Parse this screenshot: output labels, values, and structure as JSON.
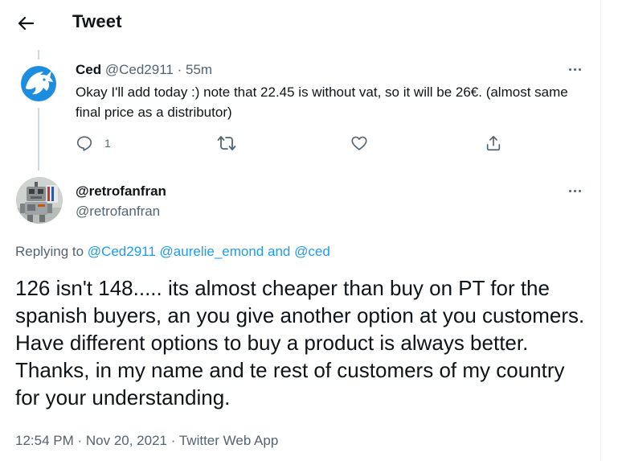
{
  "header": {
    "title": "Tweet",
    "back_icon": "arrow-left-icon"
  },
  "parent_tweet": {
    "avatar_icon": "blue-dragon-logo",
    "name": "Ced",
    "handle": "@Ced2911",
    "separator": "·",
    "time": "55m",
    "text": "Okay I'll add today :) note that 22.45 is without vat, so it will be 26€. (almost same final price as a distributor)",
    "actions": {
      "reply_count": "1",
      "reply_icon": "reply-icon",
      "retweet_icon": "retweet-icon",
      "like_icon": "heart-icon",
      "share_icon": "share-icon"
    }
  },
  "main_tweet": {
    "name": "@retrofanfran",
    "handle": "@retrofanfran",
    "replying_prefix": "Replying to",
    "replying_user1": "@Ced2911",
    "replying_user2": "@aurelie_emond",
    "replying_and": "and",
    "replying_user3": "@ced",
    "text": "126 isn't 148..... its almost cheaper than buy on PT for the spanish buyers, an you give another option at you customers. Have different options to buy a product is always better. Thanks, in my name and te rest of customers of my country for your understanding.",
    "timestamp": "12:54 PM · Nov 20, 2021",
    "meta_separator": "·",
    "source": "Twitter Web App"
  },
  "colors": {
    "accent": "#1d9bf0",
    "muted": "#536471",
    "text": "#0f1419",
    "thread_line": "#cfd9de"
  }
}
